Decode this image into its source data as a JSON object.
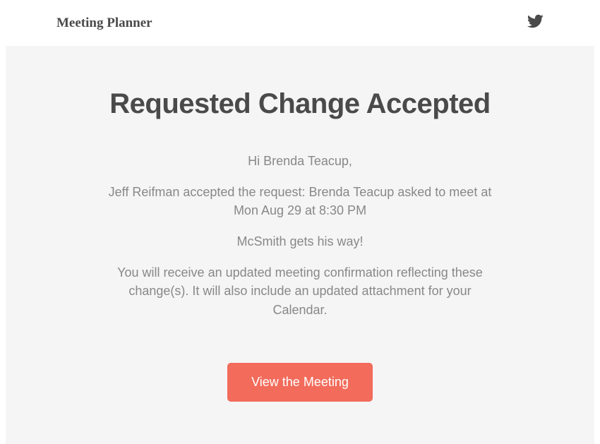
{
  "header": {
    "logo_text": "Meeting Planner"
  },
  "content": {
    "title": "Requested Change Accepted",
    "greeting": "Hi Brenda Teacup,",
    "message": "Jeff Reifman accepted the request: Brenda Teacup asked to meet at Mon Aug 29 at 8:30 PM",
    "note": "McSmith gets his way!",
    "footer_text": "You will receive an updated meeting confirmation reflecting these change(s). It will also include an updated attachment for your Calendar.",
    "cta_label": "View the Meeting"
  }
}
